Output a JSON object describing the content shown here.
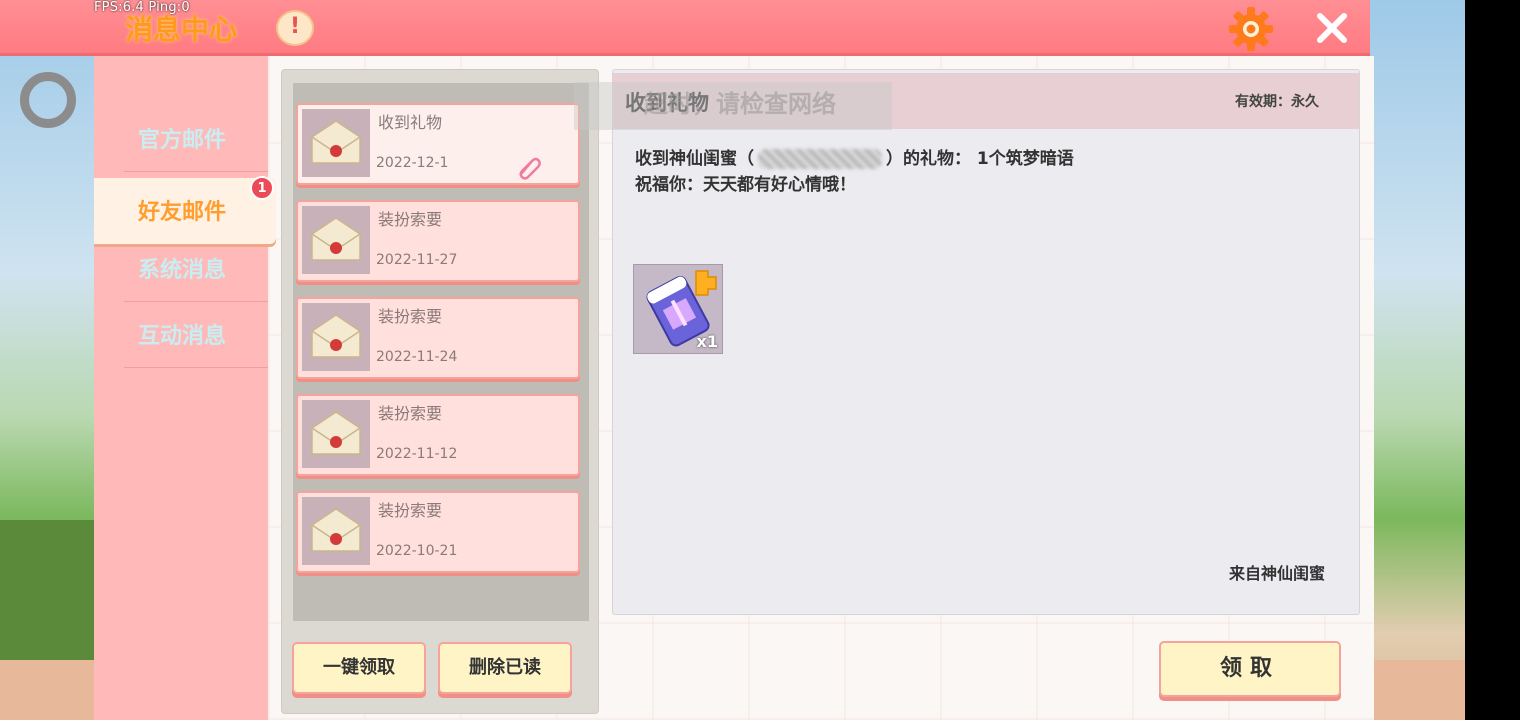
{
  "hud": {
    "fps_text": "FPS:6.4  Ping:0"
  },
  "header": {
    "title": "消息中心",
    "notice_glyph": "!"
  },
  "sidebar": {
    "items": [
      {
        "label": "官方邮件",
        "active": false
      },
      {
        "label": "好友邮件",
        "active": true,
        "badge": "1"
      },
      {
        "label": "系统消息",
        "active": false
      },
      {
        "label": "互动消息",
        "active": false
      }
    ]
  },
  "mail_list": {
    "items": [
      {
        "title": "收到礼物",
        "date": "2022-12-1",
        "has_attachment": true,
        "selected": true
      },
      {
        "title": "装扮索要",
        "date": "2022-11-27",
        "has_attachment": false,
        "selected": false
      },
      {
        "title": "装扮索要",
        "date": "2022-11-24",
        "has_attachment": false,
        "selected": false
      },
      {
        "title": "装扮索要",
        "date": "2022-11-12",
        "has_attachment": false,
        "selected": false
      },
      {
        "title": "装扮索要",
        "date": "2022-10-21",
        "has_attachment": false,
        "selected": false
      }
    ],
    "claim_all_label": "一键领取",
    "delete_read_label": "删除已读"
  },
  "detail": {
    "title": "收到礼物",
    "validity": "有效期：永久",
    "line1_prefix": "收到神仙闺蜜（",
    "line1_suffix": "）的礼物： 1个筑梦暗语",
    "line2": "祝福你：天天都有好心情哦！",
    "reward_qty": "x1",
    "sender": "来自神仙闺蜜",
    "claim_label": "领取"
  },
  "toast": {
    "text": "超时，请检查网络"
  },
  "colors": {
    "title_bar": "#ff7b82",
    "sidebar_bg": "#ffb9b9",
    "accent_orange": "#ff9d2f",
    "badge_red": "#ea4b56",
    "button_cream": "#fff4c6"
  }
}
